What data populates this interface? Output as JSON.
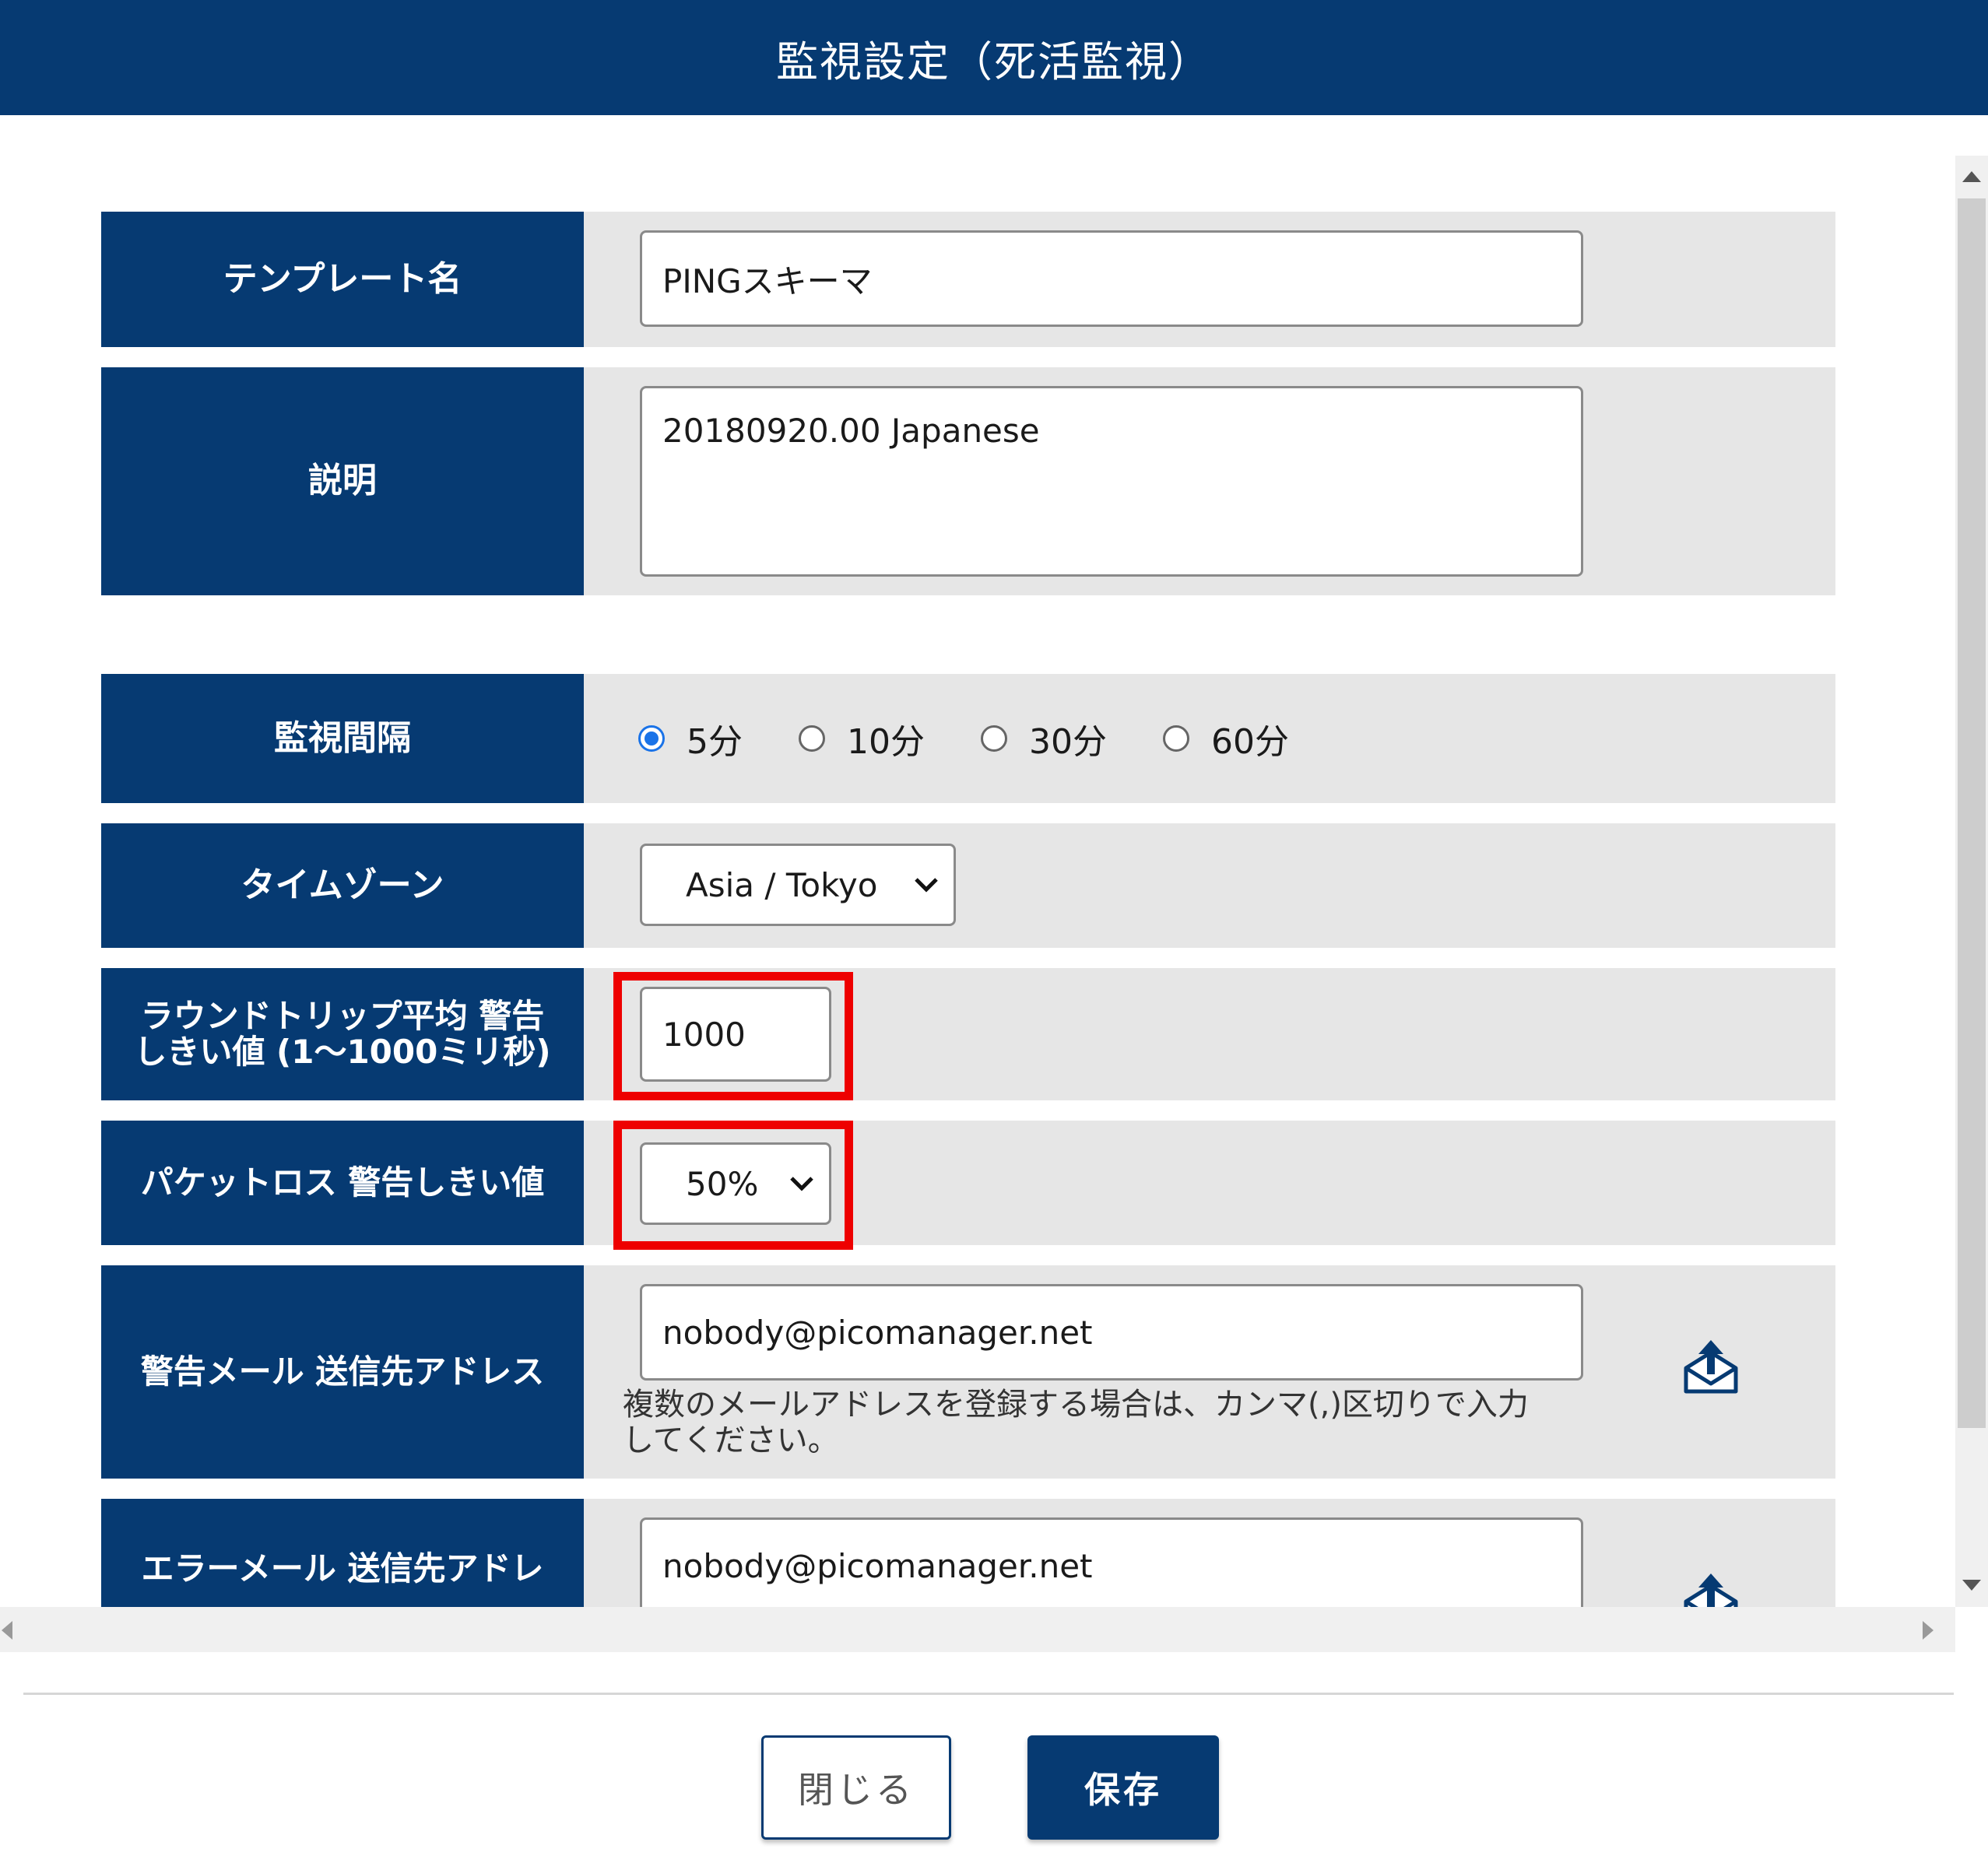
{
  "dialog": {
    "title": "監視設定（死活監視）"
  },
  "form": {
    "template_name": {
      "label": "テンプレート名",
      "value": "PINGスキーマ"
    },
    "description": {
      "label": "説明",
      "value": "20180920.00 Japanese"
    },
    "interval": {
      "label": "監視間隔",
      "options": [
        "5分",
        "10分",
        "30分",
        "60分"
      ],
      "selected": "5分"
    },
    "timezone": {
      "label": "タイムゾーン",
      "value": "Asia / Tokyo"
    },
    "rtt_threshold": {
      "label_line1": "ラウンドトリップ平均 警告",
      "label_line2": "しきい値 (1～1000ミリ秒)",
      "value": "1000"
    },
    "packet_loss": {
      "label": "パケットロス 警告しきい値",
      "value": "50%"
    },
    "warning_mail": {
      "label": "警告メール 送信先アドレス",
      "value": "nobody@picomanager.net",
      "hint_line1": "複数のメールアドレスを登録する場合は、カンマ(,)区切りで入力",
      "hint_line2": "してください。"
    },
    "error_mail": {
      "label": "エラーメール 送信先アドレ",
      "value": "nobody@picomanager.net"
    }
  },
  "footer": {
    "close_label": "閉じる",
    "save_label": "保存"
  },
  "colors": {
    "primary": "#063a72",
    "highlight": "#ee0000",
    "radio_accent": "#1a73e8",
    "row_bg": "#e6e6e6"
  },
  "icons": [
    "mail-send-icon",
    "chevron-down-icon",
    "scroll-up-icon",
    "scroll-down-icon",
    "scroll-left-icon",
    "scroll-right-icon"
  ]
}
